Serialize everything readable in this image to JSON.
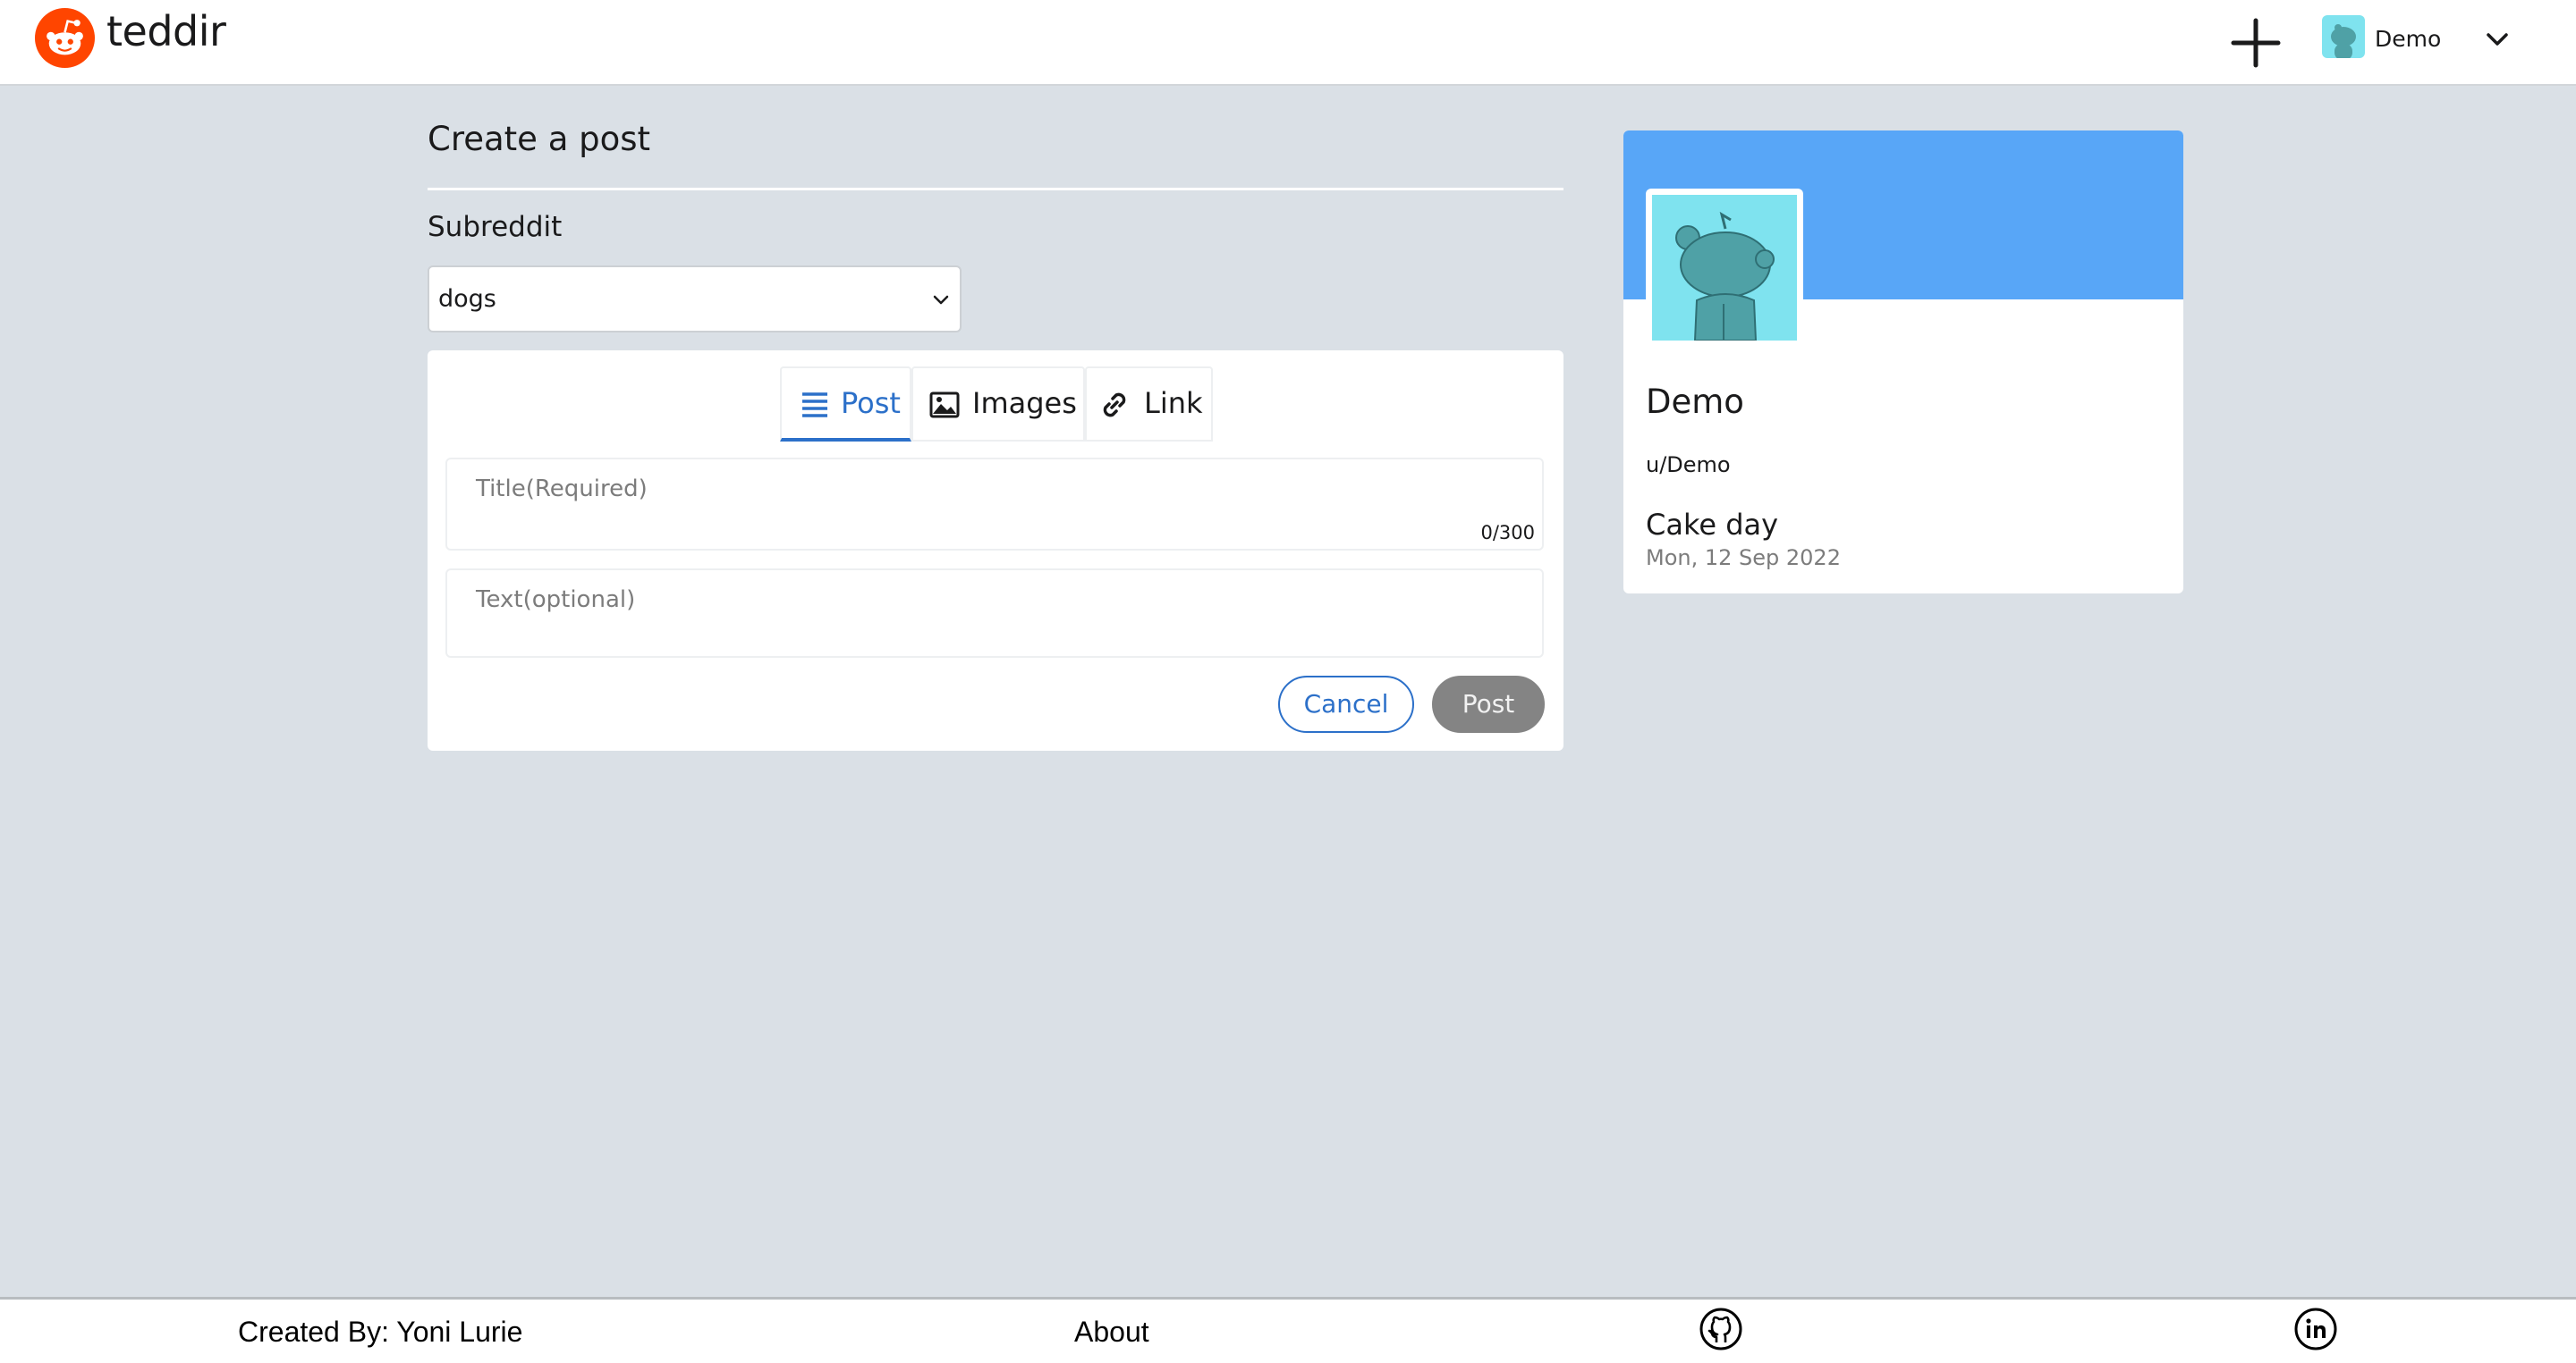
{
  "header": {
    "app_name": "teddir",
    "username": "Demo",
    "icons": {
      "logo": "snoo-logo-icon",
      "create": "plus-icon",
      "menu": "chevron-down-icon"
    },
    "brand_color": "#ff4500"
  },
  "main": {
    "page_title": "Create a post",
    "subreddit_label": "Subreddit",
    "subreddit_selected": "dogs",
    "tabs": [
      {
        "label": "Post",
        "icon": "text-lines-icon",
        "active": true
      },
      {
        "label": "Images",
        "icon": "image-icon",
        "active": false
      },
      {
        "label": "Link",
        "icon": "link-icon",
        "active": false
      }
    ],
    "title_field": {
      "placeholder": "Title(Required)",
      "counter": "0/300"
    },
    "text_field": {
      "placeholder": "Text(optional)"
    },
    "cancel_label": "Cancel",
    "post_label": "Post",
    "accent_color": "#2c70c9"
  },
  "profile": {
    "display_name": "Demo",
    "handle": "u/Demo",
    "cake_label": "Cake day",
    "cake_date": "Mon, 12 Sep 2022",
    "banner_color": "#58a6f7",
    "avatar_color": "#7fe3ef"
  },
  "footer": {
    "credit": "Created By: Yoni Lurie",
    "about": "About",
    "icons": [
      "github-icon",
      "linkedin-icon"
    ]
  }
}
